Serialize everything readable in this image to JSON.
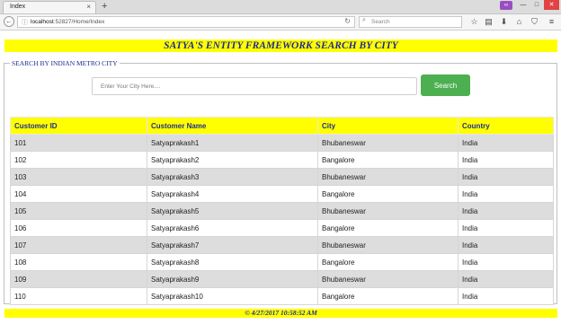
{
  "browser": {
    "tab_title": "Index",
    "tab_close": "×",
    "new_tab": "+",
    "url_host": "localhost",
    "url_path": ":52827/Home/Index",
    "search_placeholder": "Search",
    "icons": [
      "back-arrow-icon",
      "info-icon",
      "reload-icon",
      "search-icon",
      "bookmark-star-icon",
      "reading-list-icon",
      "download-icon",
      "home-icon",
      "pocket-icon",
      "menu-icon"
    ]
  },
  "page": {
    "title": "SATYA'S ENTITY FRAMEWORK SEARCH BY CITY",
    "legend": "SEARCH BY INDIAN METRO CITY",
    "city_placeholder": "Enter Your City Here....",
    "search_button": "Search",
    "footer": "© 4/27/2017 10:58:52 AM"
  },
  "table": {
    "headers": [
      "Customer ID",
      "Customer Name",
      "City",
      "Country"
    ],
    "rows": [
      [
        "101",
        "Satyaprakash1",
        "Bhubaneswar",
        "India"
      ],
      [
        "102",
        "Satyaprakash2",
        "Bangalore",
        "India"
      ],
      [
        "103",
        "Satyaprakash3",
        "Bhubaneswar",
        "India"
      ],
      [
        "104",
        "Satyaprakash4",
        "Bangalore",
        "India"
      ],
      [
        "105",
        "Satyaprakash5",
        "Bhubaneswar",
        "India"
      ],
      [
        "106",
        "Satyaprakash6",
        "Bangalore",
        "India"
      ],
      [
        "107",
        "Satyaprakash7",
        "Bhubaneswar",
        "India"
      ],
      [
        "108",
        "Satyaprakash8",
        "Bangalore",
        "India"
      ],
      [
        "109",
        "Satyaprakash9",
        "Bhubaneswar",
        "India"
      ],
      [
        "110",
        "Satyaprakash10",
        "Bangalore",
        "India"
      ]
    ]
  },
  "colors": {
    "highlight": "#ffff00",
    "heading_text": "#1f2d8f",
    "button": "#4caf50",
    "stripe": "#dddddd"
  }
}
